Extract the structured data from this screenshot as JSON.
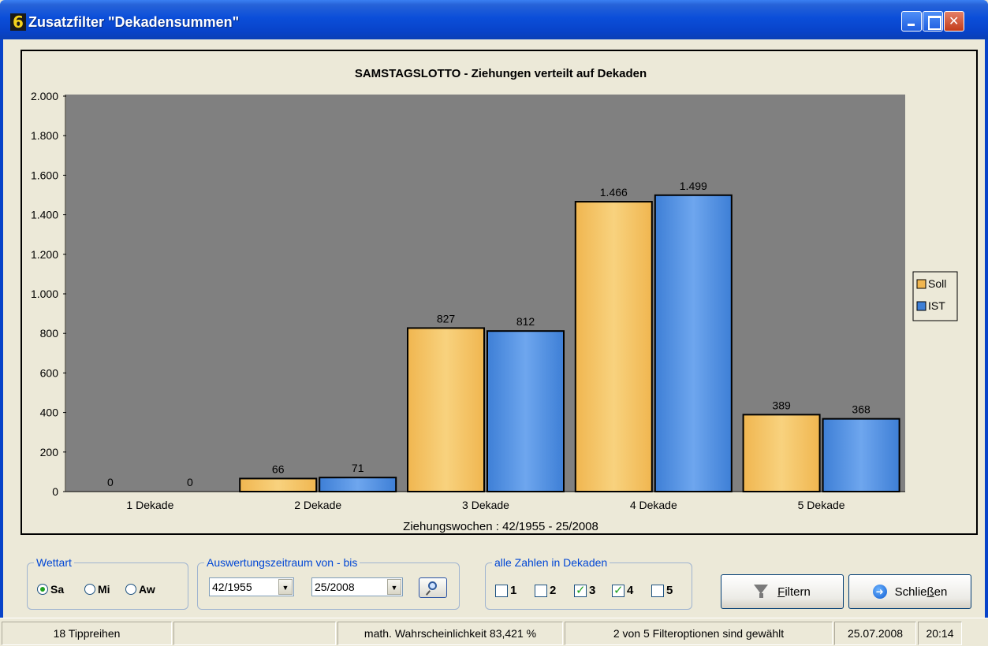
{
  "window": {
    "title": "Zusatzfilter \"Dekadensummen\"",
    "app_icon_glyph": "6"
  },
  "chart_data": {
    "type": "bar",
    "title": "SAMSTAGSLOTTO - Ziehungen verteilt auf Dekaden",
    "xlabel": "Ziehungswochen : 42/1955 - 25/2008",
    "ylabel": "",
    "categories": [
      "1 Dekade",
      "2 Dekade",
      "3 Dekade",
      "4 Dekade",
      "5 Dekade"
    ],
    "series": [
      {
        "name": "Soll",
        "values": [
          0,
          66,
          827,
          1466,
          389
        ],
        "labels": [
          "0",
          "66",
          "827",
          "1.466",
          "389"
        ],
        "color": "#f0b650"
      },
      {
        "name": "IST",
        "values": [
          0,
          71,
          812,
          1499,
          368
        ],
        "labels": [
          "0",
          "71",
          "812",
          "1.499",
          "368"
        ],
        "color": "#3e7fd6"
      }
    ],
    "ylim": [
      0,
      2000
    ],
    "yticks": [
      0,
      200,
      400,
      600,
      800,
      1000,
      1200,
      1400,
      1600,
      1800,
      2000
    ],
    "ytick_labels": [
      "0",
      "200",
      "400",
      "600",
      "800",
      "1.000",
      "1.200",
      "1.400",
      "1.600",
      "1.800",
      "2.000"
    ],
    "plot_background": "#808080",
    "grid": false,
    "legend_position": "right"
  },
  "wettart": {
    "legend": "Wettart",
    "options": [
      {
        "label": "Sa",
        "selected": true
      },
      {
        "label": "Mi",
        "selected": false
      },
      {
        "label": "Aw",
        "selected": false
      }
    ]
  },
  "zeitraum": {
    "legend": "Auswertungszeitraum von - bis",
    "from": "42/1955",
    "to": "25/2008"
  },
  "zahlen": {
    "legend": "alle Zahlen in Dekaden",
    "options": [
      {
        "label": "1",
        "checked": false
      },
      {
        "label": "2",
        "checked": false
      },
      {
        "label": "3",
        "checked": true
      },
      {
        "label": "4",
        "checked": true
      },
      {
        "label": "5",
        "checked": false
      }
    ]
  },
  "buttons": {
    "filter_first": "F",
    "filter_rest": "iltern",
    "close_pre": "Schlie",
    "close_ul": "ß",
    "close_post": "en"
  },
  "status": {
    "tippreihen": "18 Tippreihen",
    "empty": "",
    "wahrscheinlichkeit": "math. Wahrscheinlichkeit 83,421 %",
    "filteroptionen": "2 von 5 Filteroptionen sind gewählt",
    "date": "25.07.2008",
    "time": "20:14"
  }
}
